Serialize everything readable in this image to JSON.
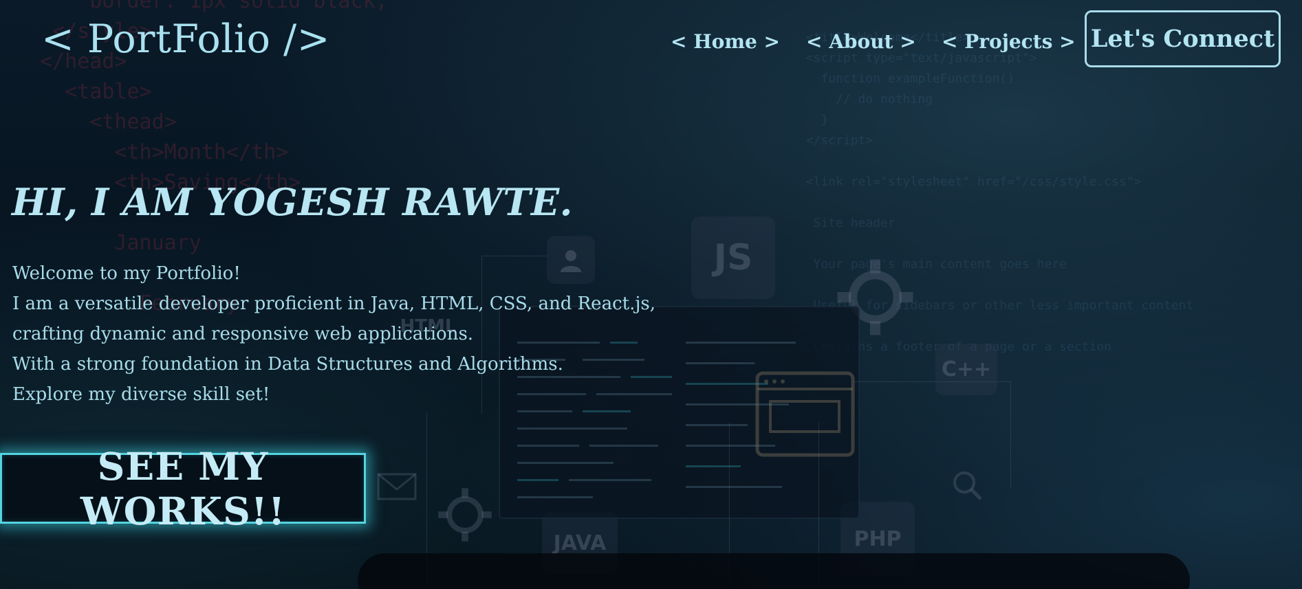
{
  "header": {
    "logo": "< PortFolio />",
    "nav": [
      "< Home >",
      "< About >",
      "< Projects >"
    ],
    "cta": "Let's Connect"
  },
  "hero": {
    "title": "HI, I AM YOGESH RAWTE.",
    "lines": [
      "Welcome to my Portfolio!",
      "I am a versatile developer proficient in Java, HTML, CSS, and React.js,",
      "crafting dynamic and responsive web applications.",
      "With a strong foundation in Data Structures and Algorithms.",
      "Explore my diverse skill set!"
    ],
    "button": "SEE MY WORKS!!"
  },
  "background": {
    "tiles": [
      "JS",
      "HTML",
      "C++",
      "JAVA",
      "PHP"
    ],
    "icons": [
      "user-icon",
      "gear-icon",
      "mail-icon",
      "search-icon",
      "browser-html-icon"
    ]
  },
  "colors": {
    "accent": "#55d3e0",
    "text": "#b3e4f2",
    "background": "#06111c"
  }
}
